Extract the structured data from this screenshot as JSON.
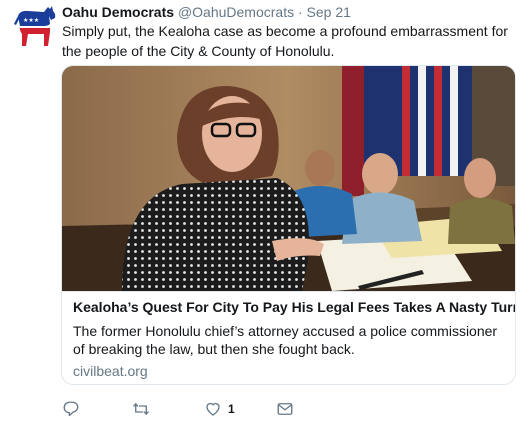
{
  "author": {
    "name": "Oahu Democrats",
    "handle": "@OahuDemocrats",
    "separator": "·",
    "date": "Sep 21"
  },
  "tweet": {
    "text": "Simply put, the Kealoha case as become a profound embarrassment for the people of the City & County of Honolulu."
  },
  "card": {
    "title": "Kealoha’s Quest For City To Pay His Legal Fees Takes A Nasty Turn",
    "description": "The former Honolulu chief’s attorney accused a police commissioner of breaking the law, but then she fought back.",
    "domain": "civilbeat.org"
  },
  "actions": {
    "reply_icon": "reply-icon",
    "retweet_icon": "retweet-icon",
    "like_icon": "heart-icon",
    "like_count": "1",
    "dm_icon": "envelope-icon"
  },
  "colors": {
    "text": "#14171a",
    "secondary": "#657786",
    "border": "#e1e8ed",
    "logo_blue": "#1a3d99",
    "logo_red": "#d1202f"
  }
}
